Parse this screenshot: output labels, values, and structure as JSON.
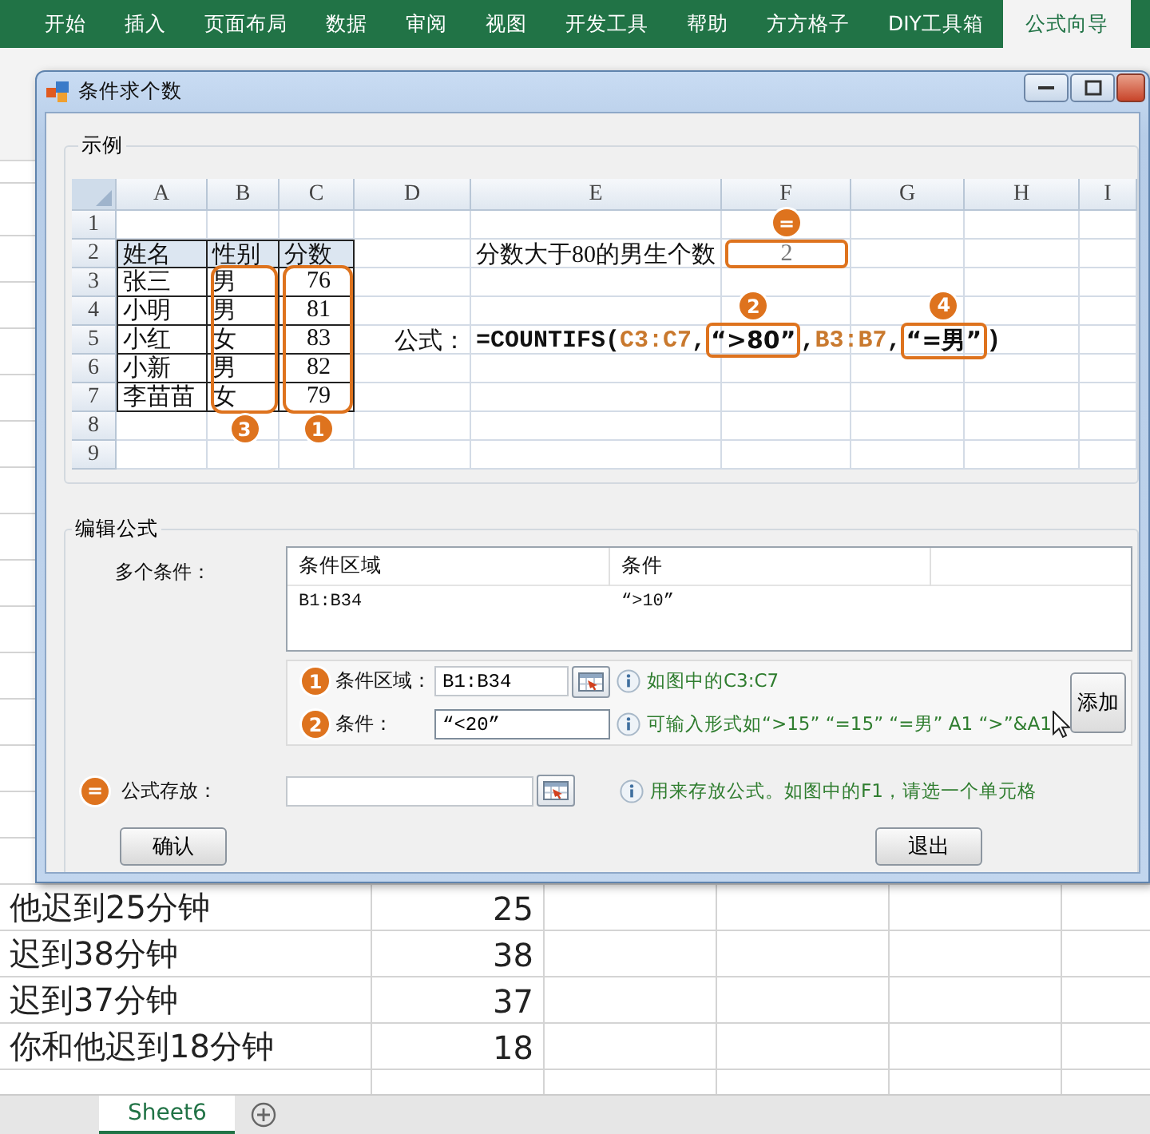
{
  "excel": {
    "ribbon_tabs": [
      {
        "label": "开始",
        "selected": false
      },
      {
        "label": "插入",
        "selected": false
      },
      {
        "label": "页面布局",
        "selected": false
      },
      {
        "label": "数据",
        "selected": false
      },
      {
        "label": "审阅",
        "selected": false
      },
      {
        "label": "视图",
        "selected": false
      },
      {
        "label": "开发工具",
        "selected": false
      },
      {
        "label": "帮助",
        "selected": false
      },
      {
        "label": "方方格子",
        "selected": false
      },
      {
        "label": "DIY工具箱",
        "selected": false
      },
      {
        "label": "公式向导",
        "selected": true
      }
    ],
    "rows": [
      {
        "col_a": "他迟到25分钟",
        "col_b": "25"
      },
      {
        "col_a": "迟到38分钟",
        "col_b": "38"
      },
      {
        "col_a": "迟到37分钟",
        "col_b": "37"
      },
      {
        "col_a": "你和他迟到18分钟",
        "col_b": "18"
      }
    ],
    "sheet_tab": "Sheet6"
  },
  "dialog": {
    "title": "条件求个数",
    "example": {
      "title": "示例",
      "columns": [
        {
          "label": "A"
        },
        {
          "label": "B",
          "bracket_badge": "3"
        },
        {
          "label": "C",
          "bracket_badge": "1"
        },
        {
          "label": "D"
        },
        {
          "label": "E"
        },
        {
          "label": "F"
        },
        {
          "label": "G"
        },
        {
          "label": "H"
        },
        {
          "label": "I"
        }
      ],
      "rows": [
        {
          "number": "1"
        },
        {
          "number": "2",
          "column_a": {
            "kind": "table_head",
            "text": "姓名"
          },
          "column_b": {
            "kind": "table_head",
            "text": "性别"
          },
          "column_c": {
            "kind": "table_head",
            "text": "分数"
          },
          "column_e": {
            "kind": "text",
            "text": "分数大于80的男生个数"
          },
          "column_f": {
            "kind": "boxed",
            "text": "2",
            "badge": "="
          }
        },
        {
          "number": "3",
          "column_a": {
            "kind": "table_text",
            "text": "张三"
          },
          "column_b": {
            "kind": "table_text",
            "text": "男"
          },
          "column_c": {
            "kind": "table_number",
            "text": "76"
          }
        },
        {
          "number": "4",
          "column_a": {
            "kind": "table_text",
            "text": "小明"
          },
          "column_b": {
            "kind": "table_text",
            "text": "男"
          },
          "column_c": {
            "kind": "table_number",
            "text": "81"
          }
        },
        {
          "number": "5",
          "column_a": {
            "kind": "table_text",
            "text": "小红"
          },
          "column_b": {
            "kind": "table_text",
            "text": "女"
          },
          "column_c": {
            "kind": "table_number",
            "text": "83"
          },
          "column_d": {
            "kind": "label",
            "text": "公式："
          },
          "column_e": {
            "kind": "formula",
            "parts": [
              {
                "kind": "plain",
                "text": "=COUNTIFS("
              },
              {
                "kind": "ref",
                "text": "C3:C7"
              },
              {
                "kind": "plain",
                "text": ","
              },
              {
                "kind": "boxed",
                "text": "“>80”",
                "badge": "2"
              },
              {
                "kind": "plain",
                "text": ","
              },
              {
                "kind": "ref",
                "text": "B3:B7"
              },
              {
                "kind": "plain",
                "text": ","
              },
              {
                "kind": "boxed",
                "text": "“=男”",
                "badge": "4"
              },
              {
                "kind": "plain",
                "text": ")"
              }
            ]
          }
        },
        {
          "number": "6",
          "column_a": {
            "kind": "table_text",
            "text": "小新"
          },
          "column_b": {
            "kind": "table_text",
            "text": "男"
          },
          "column_c": {
            "kind": "table_number",
            "text": "82"
          }
        },
        {
          "number": "7",
          "column_a": {
            "kind": "table_text",
            "text": "李苗苗"
          },
          "column_b": {
            "kind": "table_text",
            "text": "女"
          },
          "column_c": {
            "kind": "table_number",
            "text": "79"
          }
        },
        {
          "number": "8"
        },
        {
          "number": "9"
        }
      ]
    },
    "edit": {
      "title": "编辑公式",
      "conditions_label": "多个条件：",
      "list": {
        "columns": [
          "条件区域",
          "条件"
        ],
        "rows": [
          [
            "B1:B34",
            "“>10”"
          ]
        ]
      },
      "fields": [
        {
          "badge": "1",
          "label": "条件区域：",
          "value": "B1:B34",
          "picker": true,
          "hint": "如图中的C3:C7"
        },
        {
          "badge": "2",
          "label": "条件：",
          "value": "“<20”",
          "picker": false,
          "hint": "可输入形式如“>15” “=15” “=男” A1 “>”&A1"
        }
      ],
      "add_button": "添加",
      "store": {
        "badge": "=",
        "label": "公式存放：",
        "picker": true,
        "hint": "用来存放公式。如图中的F1，请选一个单元格"
      },
      "buttons": [
        "确认",
        "退出"
      ]
    }
  }
}
